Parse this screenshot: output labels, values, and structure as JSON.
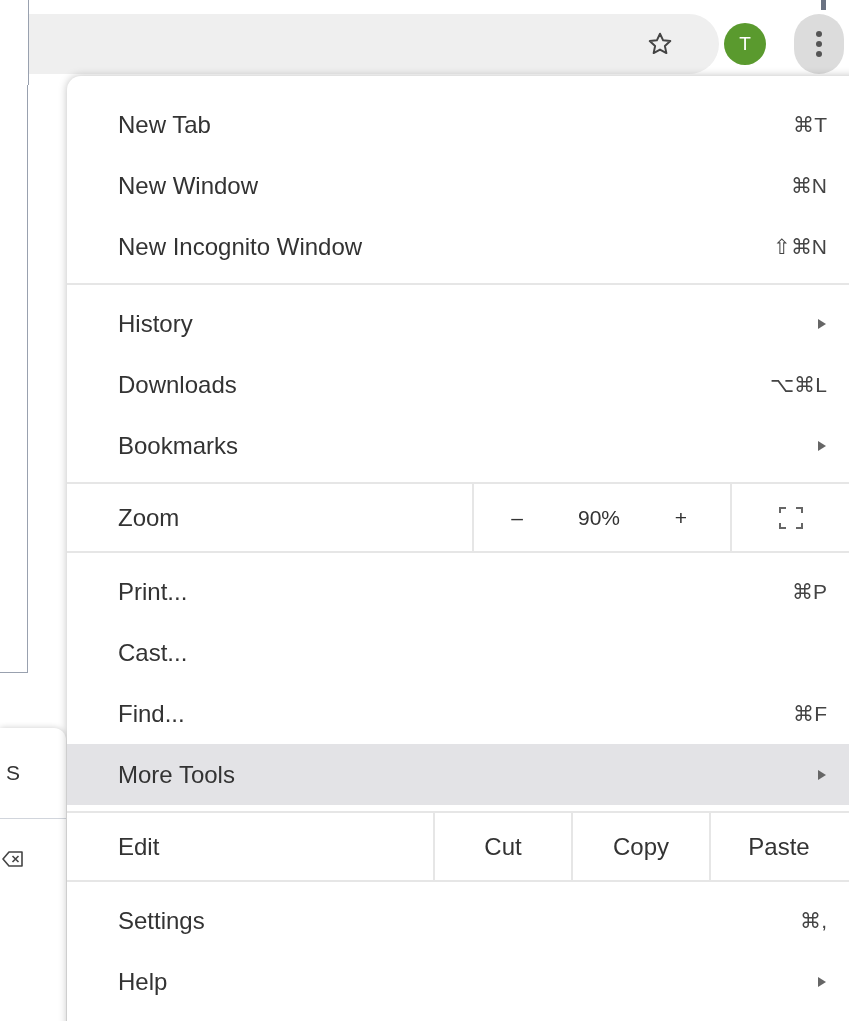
{
  "toolbar": {
    "avatar_letter": "T"
  },
  "side_submenu": {
    "shortcut": "S"
  },
  "menu": {
    "sections": [
      {
        "kind": "items",
        "items": [
          {
            "label": "New Tab",
            "shortcut": "⌘T",
            "submenu": false,
            "selected": false
          },
          {
            "label": "New Window",
            "shortcut": "⌘N",
            "submenu": false,
            "selected": false
          },
          {
            "label": "New Incognito Window",
            "shortcut": "⇧⌘N",
            "submenu": false,
            "selected": false
          }
        ]
      },
      {
        "kind": "items",
        "items": [
          {
            "label": "History",
            "submenu": true,
            "selected": false
          },
          {
            "label": "Downloads",
            "shortcut": "⌥⌘L",
            "submenu": false,
            "selected": false
          },
          {
            "label": "Bookmarks",
            "submenu": true,
            "selected": false
          }
        ]
      },
      {
        "kind": "zoom",
        "label": "Zoom",
        "minus": "–",
        "value": "90%",
        "plus": "+"
      },
      {
        "kind": "items",
        "items": [
          {
            "label": "Print...",
            "shortcut": "⌘P",
            "submenu": false,
            "selected": false
          },
          {
            "label": "Cast...",
            "submenu": false,
            "selected": false
          },
          {
            "label": "Find...",
            "shortcut": "⌘F",
            "submenu": false,
            "selected": false
          },
          {
            "label": "More Tools",
            "submenu": true,
            "selected": true
          }
        ]
      },
      {
        "kind": "edit",
        "label": "Edit",
        "buttons": [
          "Cut",
          "Copy",
          "Paste"
        ]
      },
      {
        "kind": "items",
        "items": [
          {
            "label": "Settings",
            "shortcut": "⌘,",
            "submenu": false,
            "selected": false
          },
          {
            "label": "Help",
            "submenu": true,
            "selected": false
          }
        ]
      }
    ]
  }
}
